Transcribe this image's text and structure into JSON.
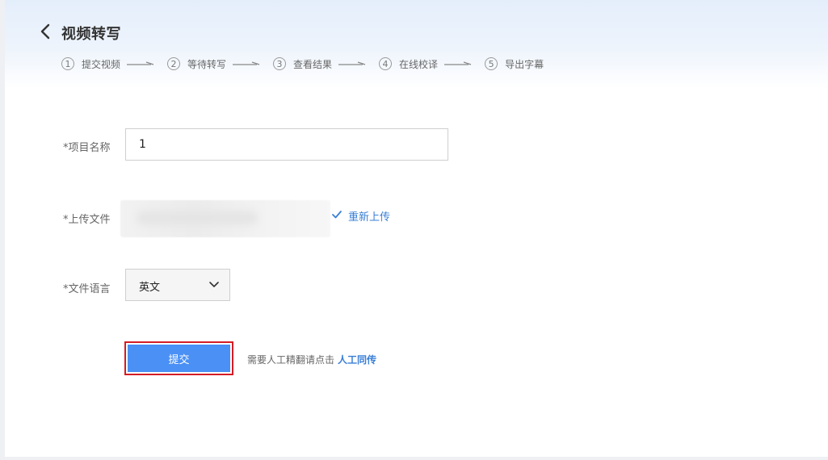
{
  "header": {
    "title": "视频转写"
  },
  "steps": [
    {
      "num": "1",
      "label": "提交视频"
    },
    {
      "num": "2",
      "label": "等待转写"
    },
    {
      "num": "3",
      "label": "查看结果"
    },
    {
      "num": "4",
      "label": "在线校译"
    },
    {
      "num": "5",
      "label": "导出字幕"
    }
  ],
  "form": {
    "project_name_label": "*项目名称",
    "project_name_value": "1",
    "upload_label": "*上传文件",
    "reupload_label": "重新上传",
    "language_label": "*文件语言",
    "language_value": "英文",
    "submit_label": "提交",
    "hint_text": "需要人工精翻请点击",
    "hint_link": "人工同传"
  },
  "colors": {
    "accent": "#4a90f5",
    "link": "#3a7fd6",
    "highlight_border": "#d41c24"
  }
}
